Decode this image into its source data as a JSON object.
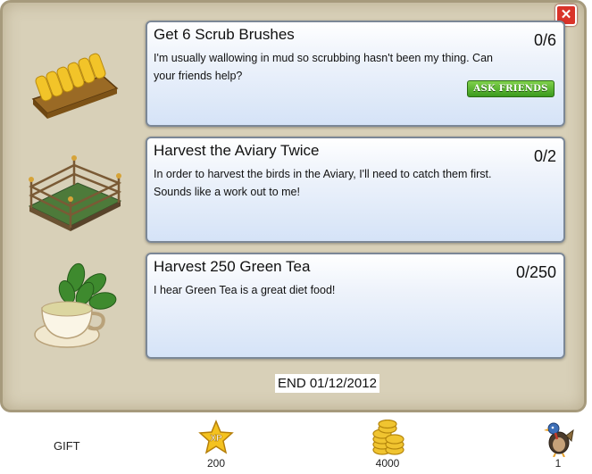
{
  "dialog": {
    "close_label": "✕"
  },
  "quests": [
    {
      "title": "Get 6 Scrub Brushes",
      "description": "I'm usually wallowing in mud so scrubbing hasn't been my thing. Can your friends help?",
      "progress": "0/6",
      "button_label": "ASK FRIENDS",
      "icon": "scrub-brush-icon"
    },
    {
      "title": "Harvest the Aviary Twice",
      "description": "In order to harvest the birds in the Aviary, I'll need to catch them first. Sounds like a work out to me!",
      "progress": "0/2",
      "icon": "aviary-icon"
    },
    {
      "title": "Harvest 250 Green Tea",
      "description": "I hear Green Tea is a great diet food!",
      "progress": "0/250",
      "icon": "green-tea-icon"
    }
  ],
  "end_date": "END 01/12/2012",
  "footer": {
    "gift_label": "GIFT",
    "xp_badge": "XP",
    "xp_value": "200",
    "coins_value": "4000",
    "item_value": "1"
  },
  "colors": {
    "panel": "#d8d0b8",
    "card_bottom": "#d5e3f7",
    "ask_button": "#4caf2a",
    "close": "#d9332a"
  }
}
